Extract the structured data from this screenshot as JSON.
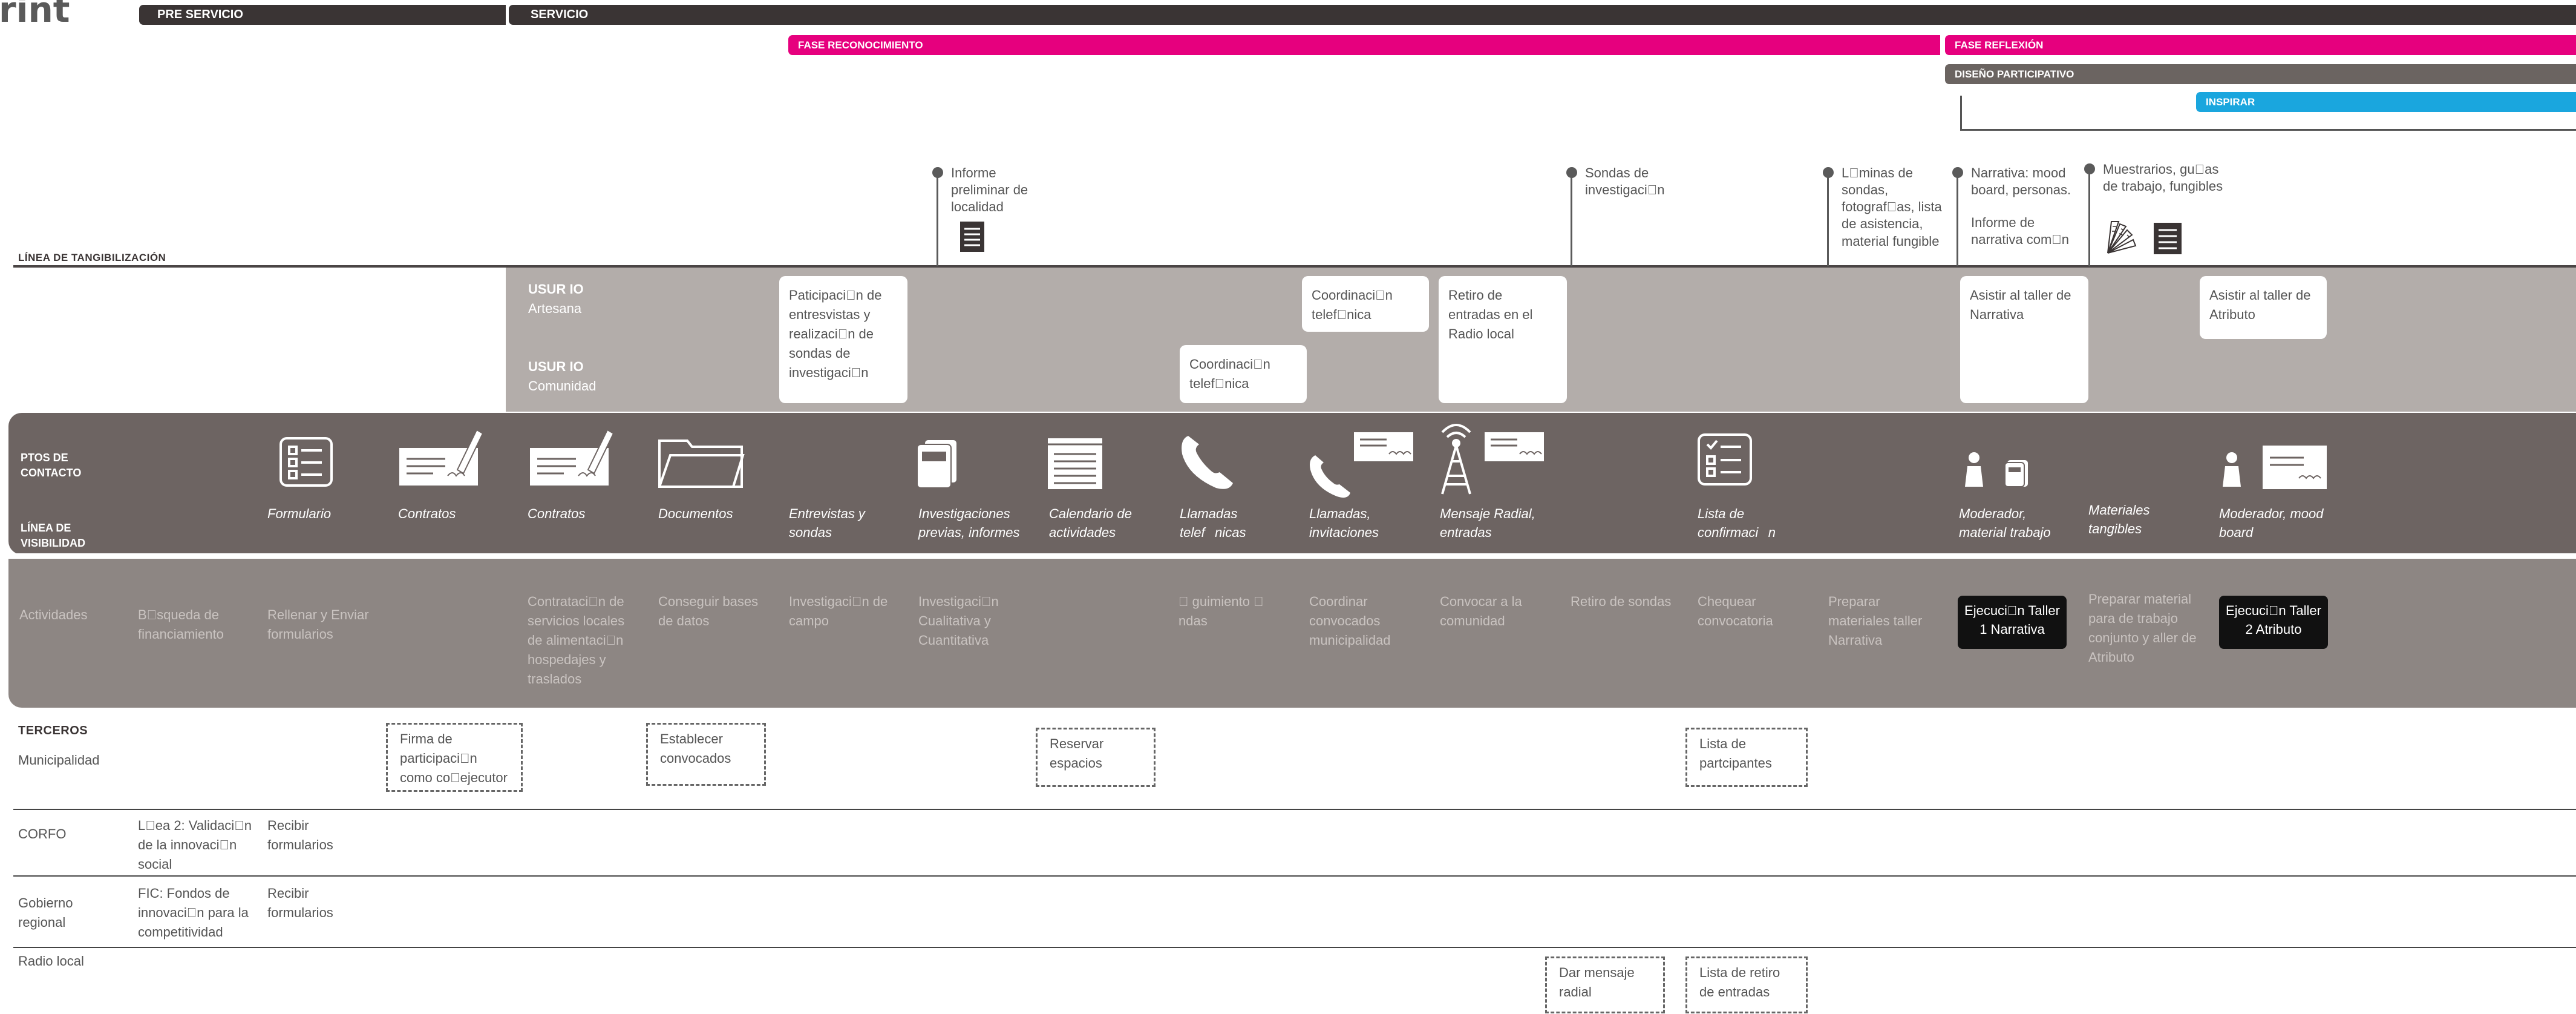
{
  "title": "rint",
  "phases": {
    "pre_servicio": "PRE SERVICIO",
    "servicio": "SERVICIO",
    "fase_reconocimiento": "FASE RECONOCIMIENTO",
    "fase_reflexion": "FASE REFLEXIÓN",
    "diseno_participativo": "DISEÑO PARTICIPATIVO",
    "inspirar": "INSPIRAR"
  },
  "linea_tangibilizacion": "LÍNEA DE TANGIBILIZACIÓN",
  "tangibles": [
    "Informe preliminar de localidad",
    "Sondas de investigaci\u0000n",
    "L\u0000minas de sondas, fotograf\u0000as, lista de asistencia, material fungible",
    "Narrativa: mood board, personas.",
    "Informe de narrativa com\u0000n",
    "Muestrarios, gu\u0000as de trabajo, fungibles"
  ],
  "usuarios": {
    "u1_title": "USUR IO",
    "u1_name": "Artesana",
    "u2_title": "USUR IO",
    "u2_name": "Comunidad"
  },
  "user_cards": [
    "Paticipaci\u0000n de entresvistas y realizaci\u0000n de sondas de investigaci\u0000n",
    "Coordinaci\u0000n telef\u0000nica",
    "Coordinaci\u0000n telef\u0000nica",
    "Retiro de entradas en el Radio local",
    "Asistir al taller de Narrativa",
    "Asistir al taller de Atributo"
  ],
  "puntos_contacto_label": "PTOS DE CONTACTO",
  "linea_visibilidad_label": "LÍNEA DE VISIBILIDAD",
  "touchpoints": [
    "Formulario",
    "Contratos",
    "Contratos",
    "Documentos",
    "Entrevistas y sondas",
    "Investigaciones previas, informes",
    "Calendario de actividades",
    "Llamadas telef\u0000nicas",
    "Llamadas, invitaciones",
    "Mensaje Radial, entradas",
    "Lista de confirmaci\u0000n",
    "Moderador, material trabajo",
    "Materiales tangibles",
    "Moderador, mood board"
  ],
  "activities_label": "Actividades",
  "activities": [
    "B\u0000squeda de financiamiento",
    "Rellenar y Enviar formularios",
    "Contrataci\u0000n de servicios locales de alimentaci\u0000n hospedajes y traslados",
    "Conseguir bases de datos",
    "Investigaci\u0000n de campo",
    "Investigaci\u0000n Cualitativa y Cuantitativa",
    "\u0000 guimiento \u0000 ndas",
    "Coordinar convocados municipalidad",
    "Convocar a la comunidad",
    "Retiro de sondas",
    "Chequear convocatoria",
    "Preparar materiales taller Narrativa",
    "Ejecuci\u0000n Taller 1 Narrativa",
    "Preparar material para de trabajo conjunto y aller de Atributo",
    "Ejecuci\u0000n Taller 2 Atributo"
  ],
  "terceros": {
    "label": "TERCEROS",
    "municipalidad": "Municipalidad",
    "corfo": "CORFO",
    "gobierno_regional": "Gobierno regional",
    "radio_local": "Radio local"
  },
  "terceros_items": {
    "firma": "Firma  de participaci\u0000n como co\u0000ejecutor",
    "establecer": "Establecer convocados",
    "reservar": "Reservar espacios",
    "lista_participantes": "Lista de partcipantes",
    "corfo_linea": "L\u0000ea 2: Validaci\u0000n de la innovaci\u0000n social",
    "corfo_recibir": "Recibir formularios",
    "gob_fic": "FIC: Fondos de innovaci\u0000n para la competitividad",
    "gob_recibir": "Recibir formularios",
    "radio_mensaje": "Dar mensaje radial",
    "radio_lista": "Lista de retiro de entradas"
  },
  "colors": {
    "dark": "#3a3434",
    "magenta": "#e6007e",
    "brown": "#6b6461",
    "blue": "#1aa6de",
    "band_light": "#b3adaa",
    "band_dark": "#6d6462",
    "band_mid": "#8d8683"
  },
  "icons": [
    "checklist-icon",
    "contract-signature-icon",
    "folder-icon",
    "document-stack-icon",
    "calendar-pad-icon",
    "phone-icon",
    "radio-tower-icon",
    "envelope-icon",
    "person-icon",
    "book-icon",
    "swatch-fan-icon"
  ]
}
